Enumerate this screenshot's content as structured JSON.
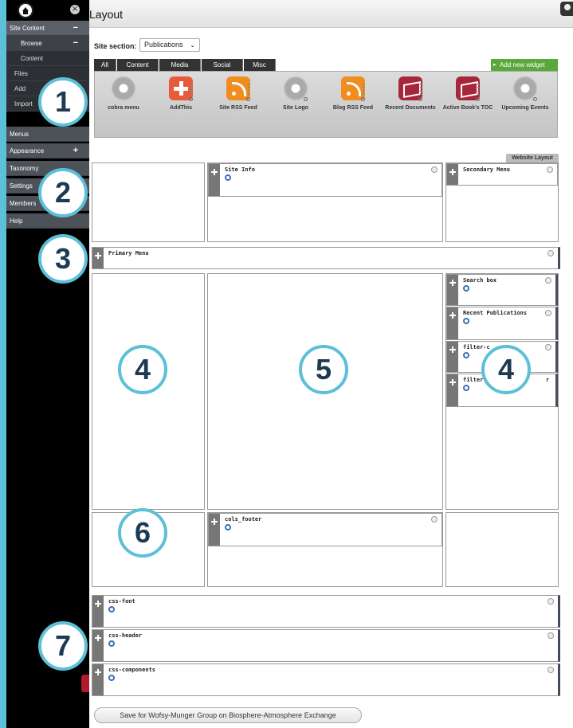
{
  "window": {
    "title": "Layout"
  },
  "sidebar": {
    "items": [
      {
        "label": "Site Content",
        "toggle": "−"
      },
      {
        "label": "Browse",
        "toggle": "−"
      },
      {
        "label": "Content"
      },
      {
        "label": "Files"
      },
      {
        "label": "Add"
      },
      {
        "label": "Import"
      },
      {
        "label": "Menus"
      },
      {
        "label": "Appearance",
        "toggle": "+"
      },
      {
        "label": "Taxonomy"
      },
      {
        "label": "Settings"
      },
      {
        "label": "Members"
      },
      {
        "label": "Help"
      }
    ]
  },
  "site_section": {
    "label": "Site section:",
    "value": "Publications"
  },
  "tabs": [
    "All",
    "Content",
    "Media",
    "Social",
    "Misc"
  ],
  "add_widget": "Add new widget",
  "palette": [
    {
      "label": "cobra menu",
      "icon": "gear-icon"
    },
    {
      "label": "AddThis",
      "icon": "plus-icon"
    },
    {
      "label": "Site RSS Feed",
      "icon": "rss-icon"
    },
    {
      "label": "Site Logo",
      "icon": "gear-icon"
    },
    {
      "label": "Blog RSS Feed",
      "icon": "rss-icon"
    },
    {
      "label": "Recent Documents",
      "icon": "book-icon"
    },
    {
      "label": "Active Book's TOC",
      "icon": "book-icon"
    },
    {
      "label": "Upcoming Events",
      "icon": "gear-icon"
    }
  ],
  "website_layout": "Website Layout",
  "widgets": {
    "site_info": "Site Info",
    "secondary_menu": "Secondary Menu",
    "primary_menu": "Primary Menu",
    "search_box": "Search box",
    "recent_publications": "Recent Publications",
    "filter_1": "filter-c",
    "filter_2": "filter-p",
    "filter_2_tail": "r",
    "cols_footer": "cols_footer",
    "css_font": "css-font",
    "css_header": "css-header",
    "css_components": "css-components"
  },
  "callouts": [
    "1",
    "2",
    "3",
    "4",
    "5",
    "4",
    "6",
    "7"
  ],
  "save_button": "Save for Wofsy-Munger Group on Biosphere-Atmosphere Exchange",
  "colors": {
    "accent": "#5bc0d8",
    "add_widget": "#5aa83c",
    "sidebar": "#000000"
  }
}
